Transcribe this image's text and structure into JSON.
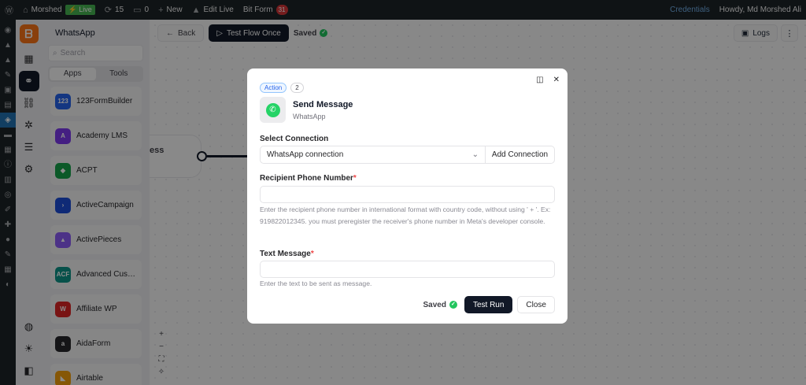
{
  "adminbar": {
    "site_name": "Morshed",
    "live_label": "Live",
    "updates_count": "15",
    "comments_count": "0",
    "new_label": "New",
    "edit_live_label": "Edit Live",
    "bitform_label": "Bit Form",
    "bitform_count": "31",
    "credentials_label": "Credentials",
    "howdy_label": "Howdy, Md Morshed Ali"
  },
  "panel": {
    "title": "WhatsApp",
    "search_placeholder": "Search",
    "tabs": [
      "Apps",
      "Tools"
    ],
    "apps": [
      {
        "name": "123FormBuilder",
        "icon": "123",
        "color": "#2563eb"
      },
      {
        "name": "Academy LMS",
        "icon": "A",
        "color": "#7c3aed"
      },
      {
        "name": "ACPT",
        "icon": "◆",
        "color": "#16a34a"
      },
      {
        "name": "ActiveCampaign",
        "icon": "›",
        "color": "#1d4ed8"
      },
      {
        "name": "ActivePieces",
        "icon": "▲",
        "color": "#8b5cf6"
      },
      {
        "name": "Advanced Custo...",
        "icon": "ACF",
        "color": "#0d9488"
      },
      {
        "name": "Affiliate WP",
        "icon": "W",
        "color": "#dc2626"
      },
      {
        "name": "AidaForm",
        "icon": "a",
        "color": "#27272a"
      },
      {
        "name": "Airtable",
        "icon": "◣",
        "color": "#f59e0b"
      }
    ]
  },
  "canvas": {
    "back_label": "Back",
    "test_flow_label": "Test Flow Once",
    "saved_label": "Saved",
    "logs_label": "Logs",
    "node_partial_text": "ess"
  },
  "modal": {
    "tag_action": "Action",
    "tag_step": "2",
    "title": "Send Message",
    "subtitle": "WhatsApp",
    "select_connection_label": "Select Connection",
    "connection_value": "WhatsApp connection",
    "add_connection_label": "Add Connection",
    "phone_label": "Recipient Phone Number",
    "phone_help": "Enter the recipient phone number in international format with country code, without using ' + '. Ex: 919822012345. you must preregister the receiver's phone number in Meta's developer console.",
    "text_label": "Text Message",
    "text_help": "Enter the text to be sent as message.",
    "required_mark": "*",
    "saved_label": "Saved",
    "test_run_label": "Test Run",
    "close_label": "Close"
  }
}
